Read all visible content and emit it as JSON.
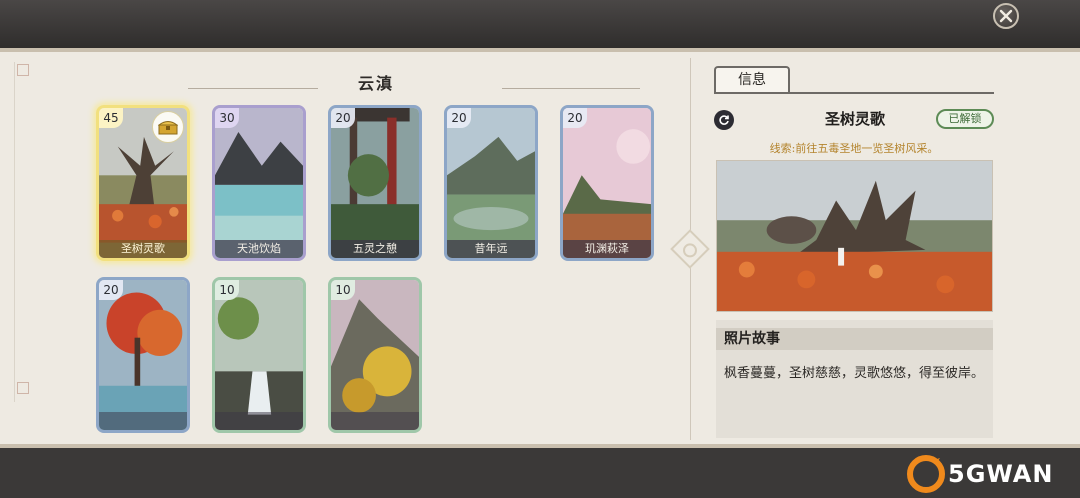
{
  "region": {
    "title": "云滇"
  },
  "cards": [
    {
      "level": "45",
      "name": "圣树灵歌",
      "rarity": "gold",
      "selected": true,
      "has_chest": true
    },
    {
      "level": "30",
      "name": "天池饮焰",
      "rarity": "purple"
    },
    {
      "level": "20",
      "name": "五灵之憩",
      "rarity": "blue"
    },
    {
      "level": "20",
      "name": "昔年远",
      "rarity": "blue"
    },
    {
      "level": "20",
      "name": "玑渊萩泽",
      "rarity": "blue"
    },
    {
      "level": "20",
      "name": "",
      "rarity": "blue"
    },
    {
      "level": "10",
      "name": "",
      "rarity": "green"
    },
    {
      "level": "10",
      "name": "",
      "rarity": "green"
    }
  ],
  "detail": {
    "tab_label": "信息",
    "title": "圣树灵歌",
    "status_badge": "已解锁",
    "clue": "线索:前往五毒圣地一览圣树风采。",
    "story_heading": "照片故事",
    "story_text": "枫香蔓蔓，圣树慈慈，灵歌悠悠，得至彼岸。"
  },
  "watermark": {
    "text": "5GWAN"
  },
  "icons": {
    "close": "close-icon",
    "refresh": "refresh-icon",
    "chest": "treasure-chest-icon"
  },
  "colors": {
    "panel_bg": "#eeeae2",
    "selected_border": "#f2e07e",
    "badge_green": "#5d8b56",
    "clue_color": "#b4842d"
  }
}
